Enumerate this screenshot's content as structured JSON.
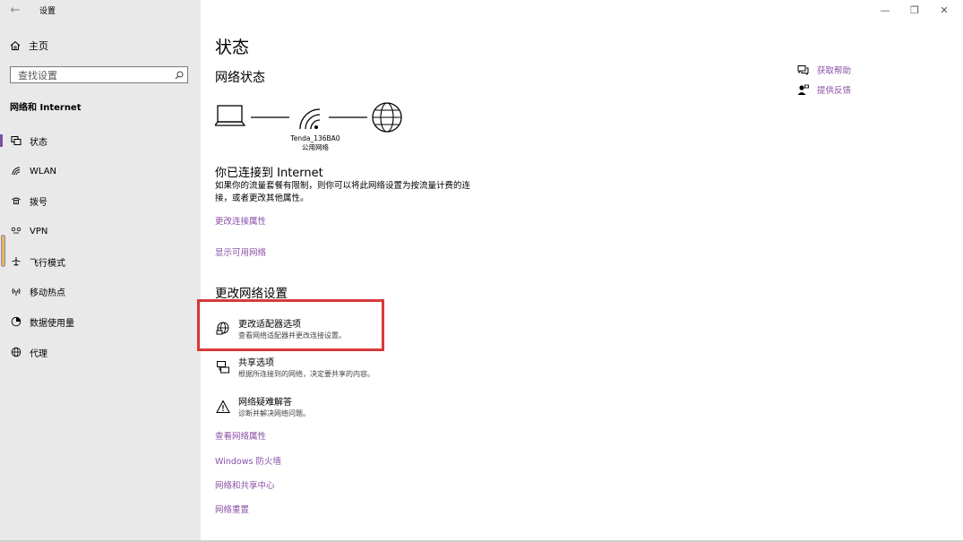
{
  "window": {
    "title": "设置",
    "minimize": "—",
    "maximize": "❐",
    "close": "✕"
  },
  "sidebar": {
    "home": "主页",
    "search_placeholder": "查找设置",
    "section": "网络和 Internet",
    "items": [
      {
        "label": "状态",
        "icon": "status-icon",
        "active": true
      },
      {
        "label": "WLAN",
        "icon": "wifi-icon"
      },
      {
        "label": "拨号",
        "icon": "dialup-icon"
      },
      {
        "label": "VPN",
        "icon": "vpn-icon"
      },
      {
        "label": "飞行模式",
        "icon": "airplane-icon"
      },
      {
        "label": "移动热点",
        "icon": "hotspot-icon"
      },
      {
        "label": "数据使用量",
        "icon": "data-usage-icon"
      },
      {
        "label": "代理",
        "icon": "proxy-icon"
      }
    ]
  },
  "main": {
    "title": "状态",
    "network_status": "网络状态",
    "ssid": "Tenda_136BA0",
    "network_type": "公用网络",
    "connected_title": "你已连接到 Internet",
    "connected_desc": "如果你的流量套餐有限制，则你可以将此网络设置为按流量计费的连接，或者更改其他属性。",
    "link_change_props": "更改连接属性",
    "link_show_networks": "显示可用网络",
    "change_settings": "更改网络设置",
    "options": [
      {
        "title": "更改适配器选项",
        "desc": "查看网络适配器并更改连接设置。",
        "icon": "adapter-globe-icon"
      },
      {
        "title": "共享选项",
        "desc": "根据所连接到的网络，决定要共享的内容。",
        "icon": "sharing-icon"
      },
      {
        "title": "网络疑难解答",
        "desc": "诊断并解决网络问题。",
        "icon": "warning-icon"
      }
    ],
    "links_bottom": [
      "查看网络属性",
      "Windows 防火墙",
      "网络和共享中心",
      "网络重置"
    ]
  },
  "help": {
    "get_help": "获取帮助",
    "feedback": "提供反馈"
  },
  "colors": {
    "accent": "#8a4fa8",
    "sidebar_bg": "#e9e9e9",
    "highlight_border": "#d8393b"
  }
}
